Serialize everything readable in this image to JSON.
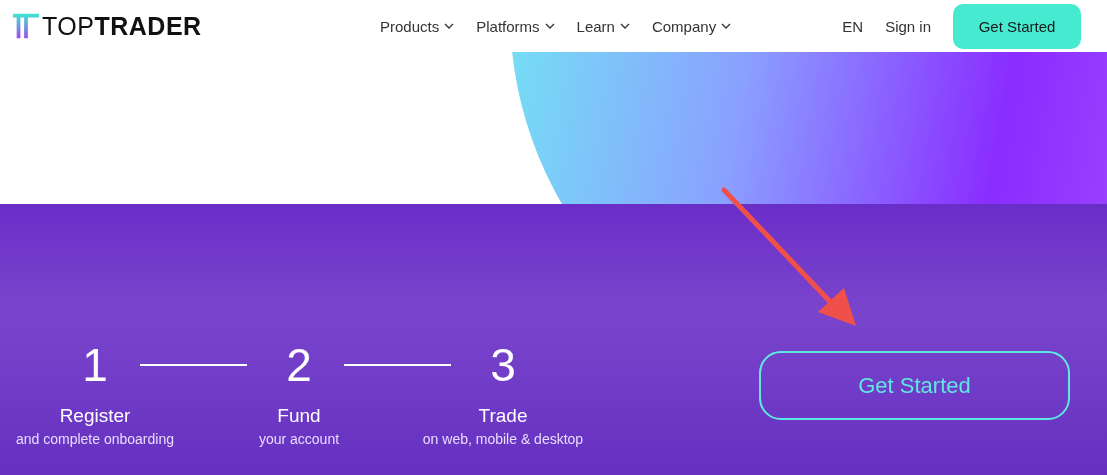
{
  "header": {
    "logo": "TOP**TRADER**",
    "nav": [
      {
        "label": "Products"
      },
      {
        "label": "Platforms"
      },
      {
        "label": "Learn"
      },
      {
        "label": "Company"
      }
    ],
    "language": "EN",
    "sign_in": "Sign in",
    "cta": "Get Started"
  },
  "steps": [
    {
      "number": "1",
      "title": "Register",
      "subtitle": "and complete onboarding"
    },
    {
      "number": "2",
      "title": "Fund",
      "subtitle": "your account"
    },
    {
      "number": "3",
      "title": "Trade",
      "subtitle": "on web, mobile & desktop"
    }
  ],
  "cta_button": "Get Started"
}
